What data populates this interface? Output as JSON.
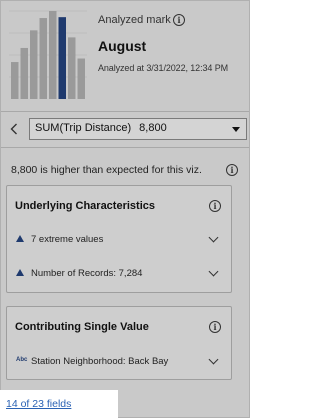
{
  "header": {
    "analyzed_label": "Analyzed mark",
    "mark_name": "August",
    "analyzed_at": "Analyzed at 3/31/2022, 12:34 PM",
    "info_icon": "info-icon"
  },
  "mini_chart": {
    "bars": [
      0.42,
      0.58,
      0.78,
      0.92,
      1.0,
      0.93,
      0.7,
      0.46
    ],
    "highlight_index": 5,
    "bar_color": "#9a9a9a",
    "highlight_color": "#1f3a6e"
  },
  "measure": {
    "name": "SUM(Trip Distance)",
    "value": "8,800",
    "back_icon": "chevron-left-icon",
    "caret_icon": "caret-down-icon"
  },
  "summary": {
    "text": "8,800 is higher than expected for this viz."
  },
  "underlying": {
    "title": "Underlying Characteristics",
    "items": [
      {
        "label": "7 extreme values",
        "icon": "triangle-up-icon"
      },
      {
        "label": "Number of Records: 7,284",
        "icon": "triangle-up-icon"
      }
    ]
  },
  "contributing": {
    "title": "Contributing Single Value",
    "items": [
      {
        "label": "Station Neighborhood: Back Bay",
        "icon": "abc-icon"
      }
    ],
    "abc": "Abc"
  },
  "footer": {
    "link": "14 of 23 fields"
  },
  "colors": {
    "overlay": "#c9c9c9",
    "link": "#2a62b4",
    "accent": "#1f3a6e"
  }
}
